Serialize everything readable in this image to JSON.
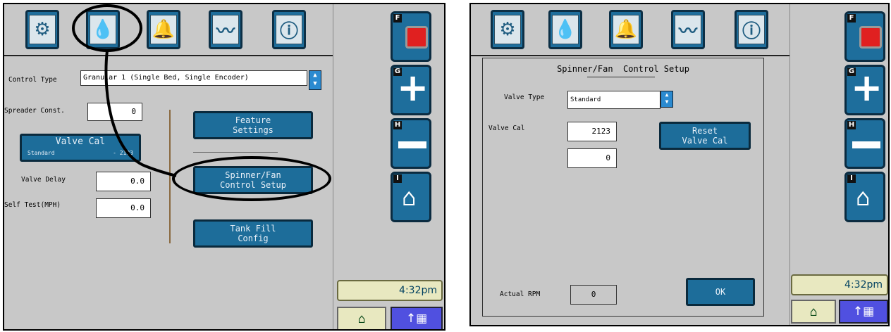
{
  "left": {
    "tabs": [
      {
        "icon": "machine-config-icon"
      },
      {
        "icon": "product-control-icon"
      },
      {
        "icon": "alarm-bell-icon"
      },
      {
        "icon": "chart-icon"
      },
      {
        "icon": "info-icon"
      }
    ],
    "control_type_label": "Control Type",
    "control_type_value": "Granular 1 (Single Bed, Single Encoder)",
    "spreader_const_label": "Spreader Const.",
    "spreader_const_value": "0",
    "valve_cal_title": "Valve Cal",
    "valve_cal_sub_left": "Standard",
    "valve_cal_sub_right": "- 2123",
    "valve_delay_label": "Valve Delay",
    "valve_delay_value": "0.0",
    "self_test_label": "Self Test(MPH)",
    "self_test_value": "0.0",
    "feature_settings_l1": "Feature",
    "feature_settings_l2": "Settings",
    "spinner_fan_l1": "Spinner/Fan",
    "spinner_fan_l2": "Control Setup",
    "tank_fill_l1": "Tank Fill",
    "tank_fill_l2": "Config"
  },
  "right": {
    "dialog_title": "Spinner/Fan  Control Setup",
    "valve_type_label": "Valve Type",
    "valve_type_value": "Standard",
    "valve_cal_label": "Valve Cal",
    "valve_cal_value": "2123",
    "second_value": "0",
    "reset_l1": "Reset",
    "reset_l2": "Valve Cal",
    "actual_rpm_label": "Actual RPM",
    "actual_rpm_value": "0",
    "ok_label": "OK"
  },
  "side": {
    "keys": [
      "F",
      "G",
      "H",
      "I"
    ],
    "clock": "4:32pm"
  },
  "colors": {
    "accent_blue": "#1e6e9c",
    "panel_gray": "#c8c8c8",
    "clock_bg": "#e8e8c0",
    "menu_blue": "#5050e0"
  }
}
